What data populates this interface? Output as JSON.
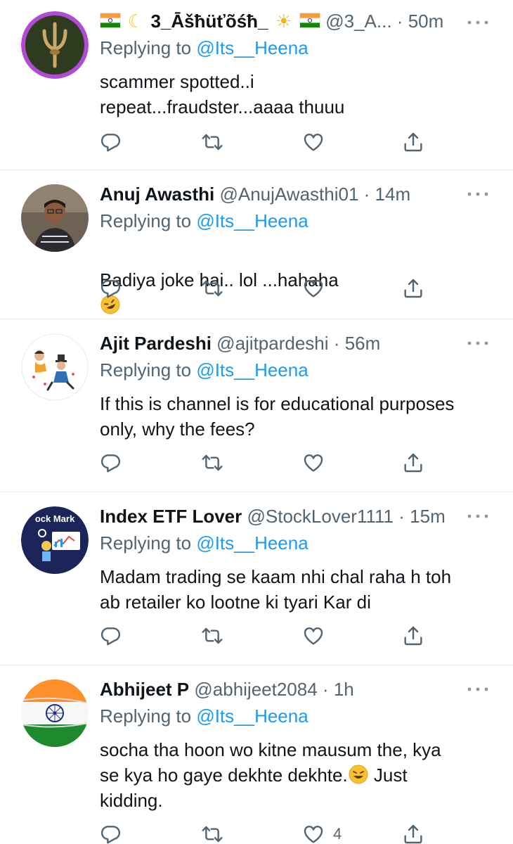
{
  "tweets": [
    {
      "name": "3_Āšħüťõśħ_",
      "handle": "@3_A...",
      "time": "50m",
      "replying_prefix": "Replying to",
      "replying_to": "@Its__Heena",
      "text": "scammer spotted..i\nrepeat...fraudster...aaaa thuuu",
      "avatar_icon": "trident-avatar",
      "name_emojis": [
        "india-flag-icon",
        "crescent-moon-icon",
        "sun-icon",
        "india-flag-icon"
      ]
    },
    {
      "name": "Anuj Awasthi",
      "handle": "@AnujAwasthi01",
      "time": "14m",
      "replying_prefix": "Replying to",
      "replying_to": "@Its__Heena",
      "text": "Badiya joke hai.. lol ...hahaha",
      "avatar_icon": "person-photo-avatar",
      "text_emoji": "rolling-laughing-emoji"
    },
    {
      "name": "Ajit Pardeshi",
      "handle": "@ajitpardeshi",
      "time": "56m",
      "replying_prefix": "Replying to",
      "replying_to": "@Its__Heena",
      "text": "If this is channel is for educational purposes\nonly, why the fees?",
      "avatar_icon": "cartoon-avatar"
    },
    {
      "name": "Index ETF Lover",
      "handle": "@StockLover1111",
      "time": "15m",
      "replying_prefix": "Replying to",
      "replying_to": "@Its__Heena",
      "text": "Madam trading se kaam nhi chal raha h toh\nab retailer ko lootne ki tyari Kar di",
      "avatar_icon": "stock-market-avatar",
      "avatar_text": "ock Mark"
    },
    {
      "name": "Abhijeet P",
      "handle": "@abhijeet2084",
      "time": "1h",
      "replying_prefix": "Replying to",
      "replying_to": "@Its__Heena",
      "text_line1": "socha tha hoon wo kitne mausum the, kya",
      "text_line2a": "se kya ho gaye dekhte dekhte.",
      "text_line2b": " Just",
      "text_line3": "kidding.",
      "avatar_icon": "india-flag-avatar",
      "text_emoji": "crying-laughing-emoji",
      "like_count": "4"
    }
  ],
  "dot": "·",
  "colors": {
    "accent": "#1d9bf0",
    "secondary": "#536471",
    "divider": "#e6ecf0"
  }
}
